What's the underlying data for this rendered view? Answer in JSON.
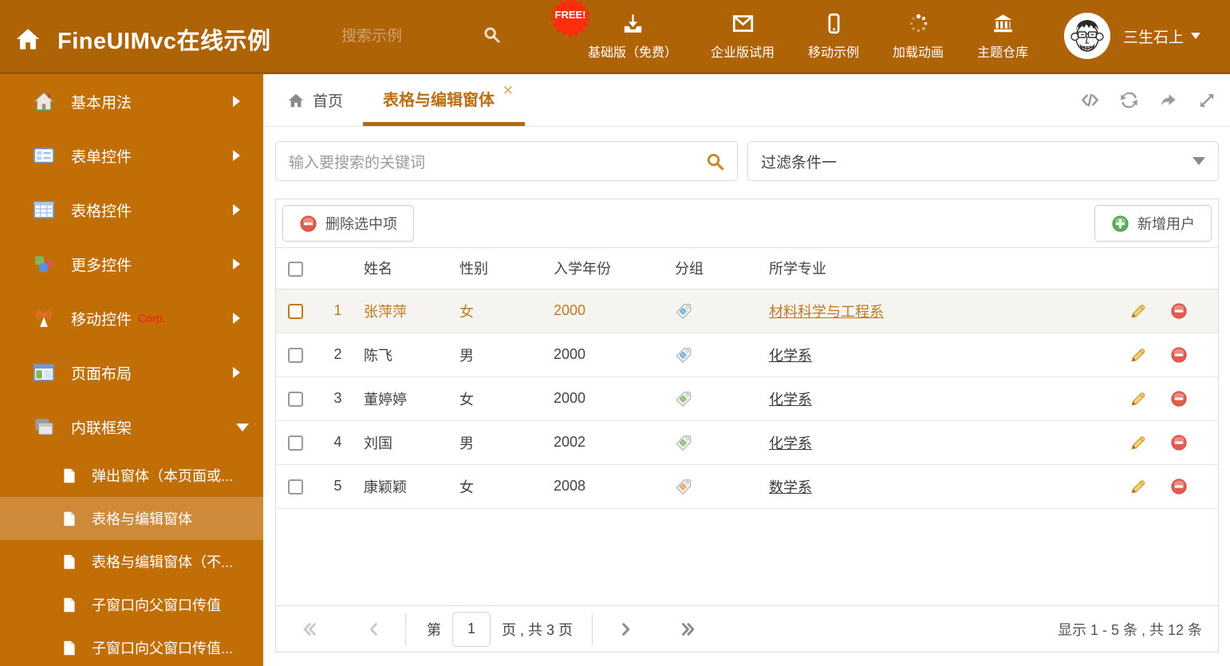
{
  "header": {
    "title": "FineUIMvc在线示例",
    "search_placeholder": "搜索示例",
    "free_badge": "FREE!",
    "nav": [
      {
        "label": "基础版（免费）",
        "icon": "download-icon"
      },
      {
        "label": "企业版试用",
        "icon": "mail-icon"
      },
      {
        "label": "移动示例",
        "icon": "mobile-icon"
      },
      {
        "label": "加载动画",
        "icon": "loading-icon"
      },
      {
        "label": "主题仓库",
        "icon": "bank-icon"
      }
    ],
    "user": {
      "name": "三生石上"
    }
  },
  "sidebar": {
    "items": [
      {
        "label": "基本用法"
      },
      {
        "label": "表单控件"
      },
      {
        "label": "表格控件"
      },
      {
        "label": "更多控件"
      },
      {
        "label": "移动控件",
        "badge": "Corp."
      },
      {
        "label": "页面布局"
      },
      {
        "label": "内联框架"
      }
    ],
    "subitems": [
      {
        "label": "弹出窗体（本页面或..."
      },
      {
        "label": "表格与编辑窗体",
        "active": true
      },
      {
        "label": "表格与编辑窗体（不..."
      },
      {
        "label": "子窗口向父窗口传值"
      },
      {
        "label": "子窗口向父窗口传值..."
      }
    ]
  },
  "tabs": {
    "home": "首页",
    "active": "表格与编辑窗体"
  },
  "filter": {
    "search_placeholder": "输入要搜索的关键词",
    "dropdown_value": "过滤条件一"
  },
  "toolbar": {
    "delete_label": "删除选中项",
    "add_label": "新增用户"
  },
  "table": {
    "columns": [
      "姓名",
      "性别",
      "入学年份",
      "分组",
      "所学专业"
    ],
    "rows": [
      {
        "num": "1",
        "name": "张萍萍",
        "gender": "女",
        "year": "2000",
        "tag": "blue",
        "major": "材料科学与工程系",
        "selected": true
      },
      {
        "num": "2",
        "name": "陈飞",
        "gender": "男",
        "year": "2000",
        "tag": "blue",
        "major": "化学系"
      },
      {
        "num": "3",
        "name": "董婷婷",
        "gender": "女",
        "year": "2000",
        "tag": "green",
        "major": "化学系"
      },
      {
        "num": "4",
        "name": "刘国",
        "gender": "男",
        "year": "2002",
        "tag": "green",
        "major": "化学系"
      },
      {
        "num": "5",
        "name": "康颖颖",
        "gender": "女",
        "year": "2008",
        "tag": "orange",
        "major": "数学系"
      }
    ]
  },
  "pagination": {
    "prefix": "第",
    "page": "1",
    "suffix": "页 , 共 3 页",
    "summary": "显示 1 - 5 条 , 共 12 条"
  },
  "colors": {
    "header_bg": "#AF6307",
    "sidebar_bg": "#C06E05",
    "accent": "#B96F12",
    "selected_row_text": "#BE7B1D",
    "corp_badge": "#FF1A1A"
  }
}
